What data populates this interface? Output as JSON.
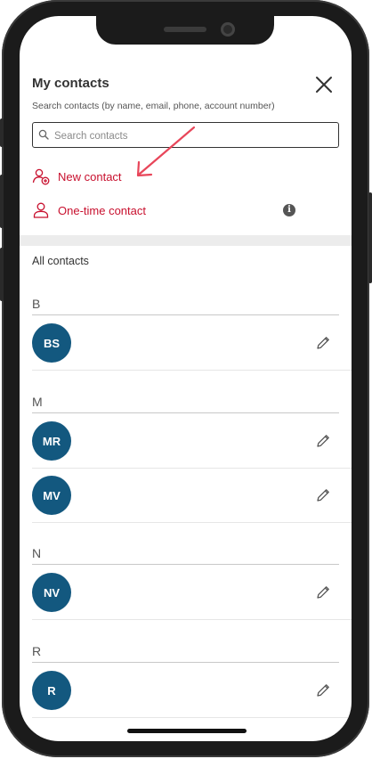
{
  "header": {
    "title": "My contacts"
  },
  "search": {
    "helper_text": "Search contacts (by name, email, phone, account number)",
    "placeholder": "Search contacts",
    "value": ""
  },
  "actions": {
    "new_contact_label": "New contact",
    "one_time_contact_label": "One-time contact"
  },
  "list": {
    "heading": "All contacts",
    "groups": [
      {
        "letter": "B",
        "contacts": [
          {
            "initials": "BS"
          }
        ]
      },
      {
        "letter": "M",
        "contacts": [
          {
            "initials": "MR"
          },
          {
            "initials": "MV"
          }
        ]
      },
      {
        "letter": "N",
        "contacts": [
          {
            "initials": "NV"
          }
        ]
      },
      {
        "letter": "R",
        "contacts": [
          {
            "initials": "R"
          }
        ]
      }
    ]
  },
  "colors": {
    "accent": "#c8102e",
    "avatar_bg": "#13587f",
    "arrow": "#e8465a"
  },
  "icons": {
    "close": "close-icon",
    "search": "search-icon",
    "new_contact": "add-person-icon",
    "one_time": "person-icon",
    "info": "info-icon",
    "edit": "pencil-icon"
  }
}
